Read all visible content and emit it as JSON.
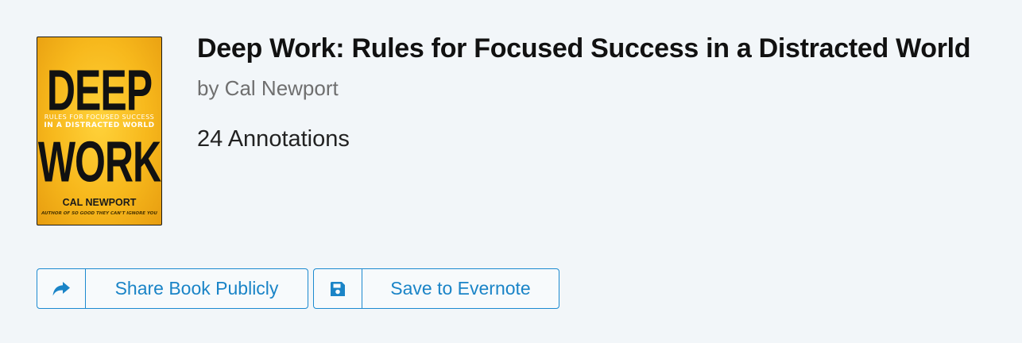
{
  "book": {
    "cover": {
      "line1": "DEEP",
      "subtitle_line1": "RULES FOR FOCUSED SUCCESS",
      "subtitle_line2": "IN A DISTRACTED WORLD",
      "line2": "WORK",
      "author": "CAL NEWPORT",
      "tagline": "AUTHOR OF SO GOOD THEY CAN'T IGNORE YOU"
    },
    "title": "Deep Work: Rules for Focused Success in a Distracted World",
    "byline": "by Cal Newport",
    "annotations": "24 Annotations"
  },
  "actions": {
    "share_label": "Share Book Publicly",
    "share_icon": "share-arrow-icon",
    "save_label": "Save to Evernote",
    "save_icon": "floppy-disk-icon"
  },
  "colors": {
    "background": "#f2f6f9",
    "accent": "#1c8ad0",
    "cover": "#f7b81c"
  }
}
